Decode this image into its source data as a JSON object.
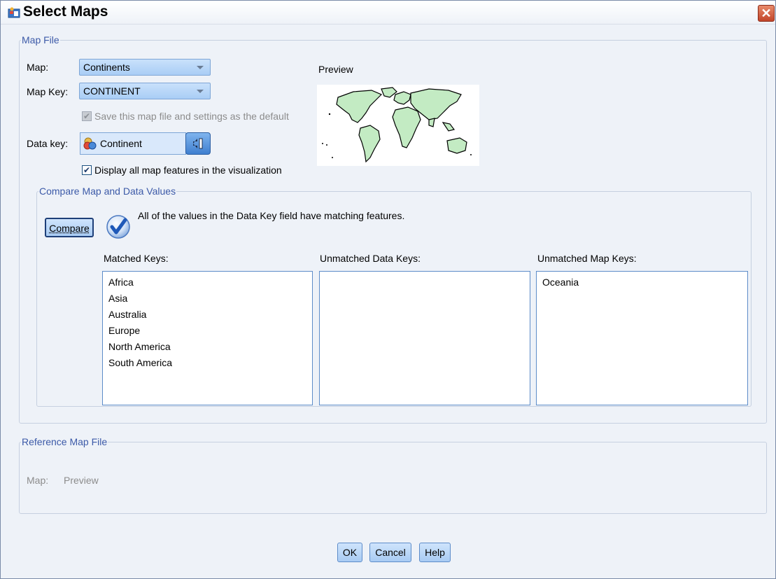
{
  "window": {
    "title": "Select Maps",
    "close_glyph": "✕"
  },
  "map_file": {
    "legend": "Map File",
    "map_label": "Map:",
    "map_value": "Continents",
    "map_key_label": "Map Key:",
    "map_key_value": "CONTINENT",
    "save_default_label": "Save this map file and settings as the default",
    "save_default_checked": true,
    "save_default_enabled": false,
    "data_key_label": "Data key:",
    "data_key_value": "Continent",
    "display_all_label": "Display all map features in the visualization",
    "display_all_checked": true,
    "preview_label": "Preview",
    "preview_icon": "world-map-icon"
  },
  "compare": {
    "legend": "Compare Map and Data Values",
    "button_label": "Compare",
    "status_icon": "checkmark-circle-icon",
    "status_message": "All of the values in the Data Key field have matching features.",
    "matched_label": "Matched Keys:",
    "matched_keys": [
      "Africa",
      "Asia",
      "Australia",
      "Europe",
      "North America",
      "South America"
    ],
    "unmatched_data_label": "Unmatched Data Keys:",
    "unmatched_data_keys": [],
    "unmatched_map_label": "Unmatched Map Keys:",
    "unmatched_map_keys": [
      "Oceania"
    ]
  },
  "reference_map": {
    "legend": "Reference Map File",
    "map_label": "Map:",
    "preview_label": "Preview"
  },
  "buttons": {
    "ok": "OK",
    "cancel": "Cancel",
    "help": "Help"
  },
  "colors": {
    "legend_blue": "#3c5aa8",
    "button_gradient_top": "#cfe4fc",
    "check_green": "#21a121",
    "map_land": "#c3ebc3"
  }
}
